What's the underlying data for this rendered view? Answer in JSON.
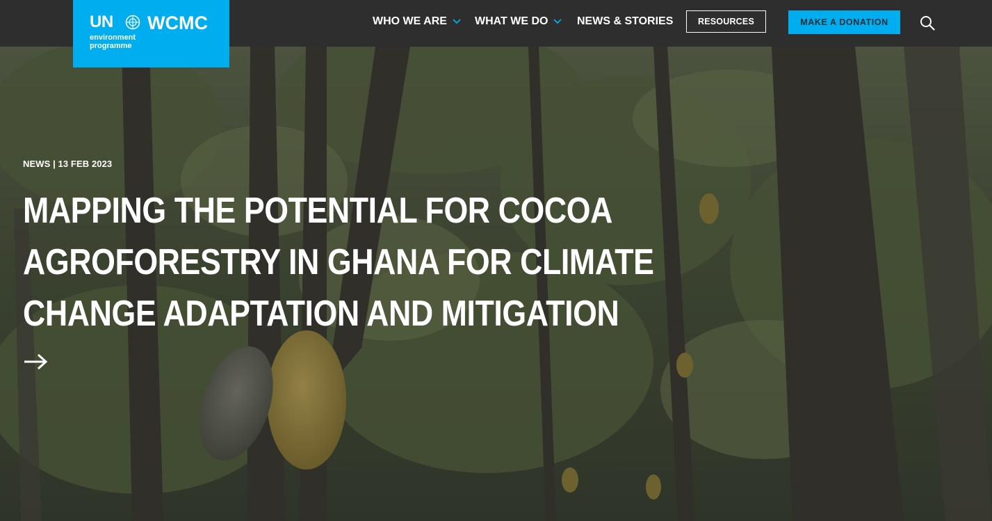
{
  "site": {
    "logo": {
      "un": "UN",
      "wcmc": "WCMC",
      "sub_line1": "environment",
      "sub_line2": "programme",
      "brand_color": "#00aeef"
    }
  },
  "nav": {
    "items": [
      {
        "label": "WHO WE ARE",
        "has_dropdown": true
      },
      {
        "label": "WHAT WE DO",
        "has_dropdown": true
      },
      {
        "label": "NEWS & STORIES",
        "has_dropdown": false
      }
    ],
    "resources_label": "RESOURCES",
    "donate_label": "MAKE A DONATION",
    "search_icon": "search-icon",
    "chevron_color": "#00aeef"
  },
  "hero": {
    "meta": "NEWS | 13 FEB 2023",
    "headline_lines": [
      "MAPPING THE POTENTIAL FOR COCOA",
      "AGROFORESTRY IN GHANA FOR CLIMATE",
      "CHANGE ADAPTATION AND MITIGATION"
    ],
    "arrow_icon": "arrow-right-icon"
  }
}
